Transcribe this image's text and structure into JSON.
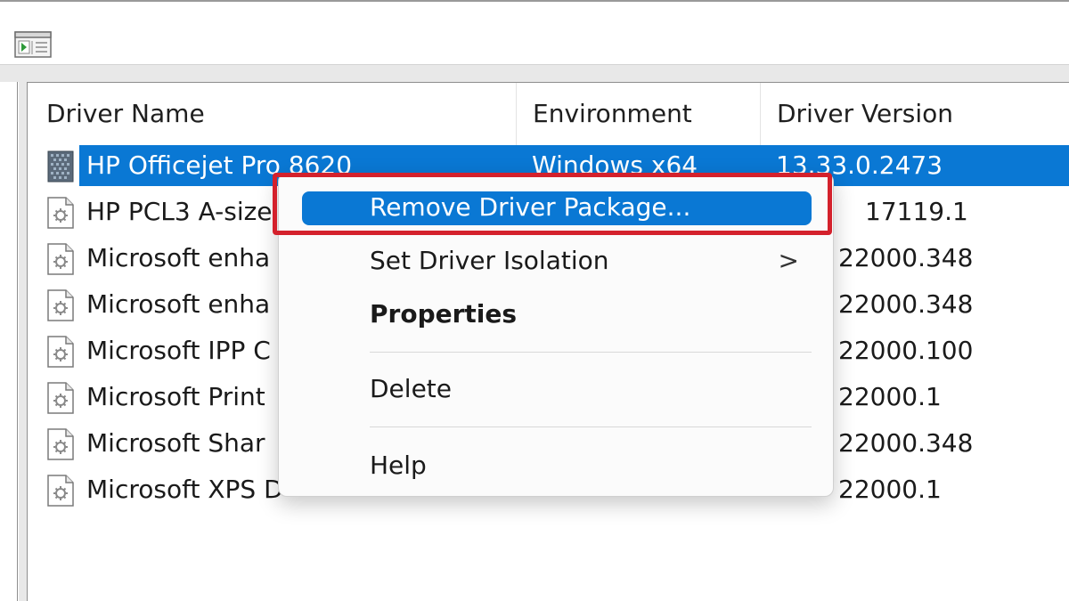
{
  "toolbar": {
    "icon": "show-hide-console-tree-icon"
  },
  "list": {
    "columns": [
      "Driver Name",
      "Environment",
      "Driver Version"
    ],
    "rows": [
      {
        "name": "HP Officejet Pro 8620",
        "environment": "Windows x64",
        "version": "13.33.0.2473",
        "selected": true
      },
      {
        "name": "HP PCL3 A-size",
        "environment": "",
        "version": "17119.1",
        "selected": false
      },
      {
        "name": "Microsoft enha",
        "environment": "",
        "version": "22000.348",
        "selected": false
      },
      {
        "name": "Microsoft enha",
        "environment": "",
        "version": "22000.348",
        "selected": false
      },
      {
        "name": "Microsoft IPP C",
        "environment": "",
        "version": "22000.100",
        "selected": false
      },
      {
        "name": "Microsoft Print",
        "environment": "",
        "version": "22000.1",
        "selected": false
      },
      {
        "name": "Microsoft Shar",
        "environment": "",
        "version": "22000.348",
        "selected": false
      },
      {
        "name": "Microsoft XPS D",
        "environment": "",
        "version": "22000.1",
        "selected": false
      }
    ]
  },
  "context_menu": {
    "items": [
      {
        "label": "Remove Driver Package...",
        "highlighted": true
      },
      {
        "label": "Set Driver Isolation",
        "submenu_arrow": ">"
      },
      {
        "label": "Properties",
        "bold": true
      },
      {
        "label": "Delete"
      },
      {
        "label": "Help"
      }
    ]
  },
  "colors": {
    "selection": "#0a78d4",
    "annotation_box": "#d4212c"
  }
}
